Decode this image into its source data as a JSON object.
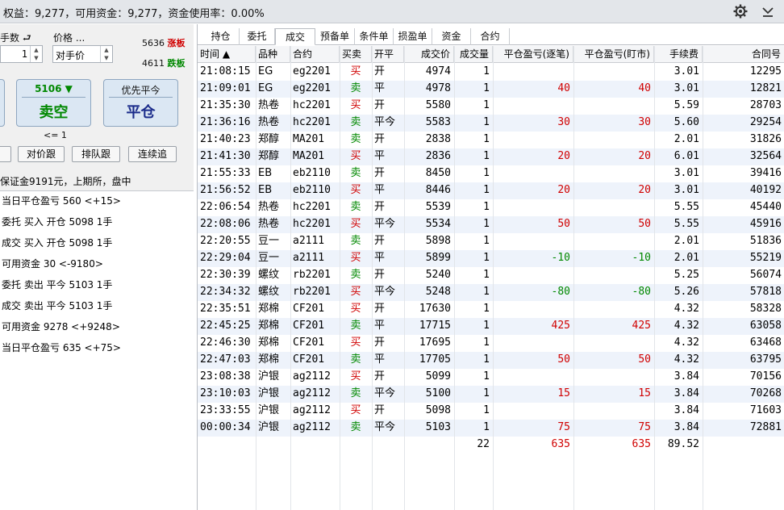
{
  "topbar": {
    "summary": "权益：9,277，可用资金：9,277，资金使用率：0.00%",
    "icons": [
      "gear-icon",
      "chevron-down-icon"
    ]
  },
  "order_panel": {
    "qty_label": "手数",
    "qty_value": "1",
    "price_label": "价格 ...",
    "price_value": "对手价",
    "limit_up_value": "5636",
    "limit_up_label": "涨板",
    "limit_down_value": "4611",
    "limit_down_label": "跌板",
    "sell_price": "5106",
    "sell_label": "卖空",
    "close_top": "优先平今",
    "close_label": "平仓",
    "hint": "<= 1",
    "btn_counter": "对价跟",
    "btn_queue": "排队跟",
    "btn_chase": "连续追",
    "margin_info": "保证金9191元，上期所，盘中"
  },
  "log": [
    "当日平仓盈亏 560  <+15>",
    "委托  买入  开仓  5098  1手",
    "成交  买入  开仓  5098  1手",
    "可用资金 30  <-9180>",
    "委托  卖出  平今  5103  1手",
    "成交  卖出  平今  5103  1手",
    "可用资金 9278  <+9248>",
    "当日平仓盈亏 635  <+75>"
  ],
  "tabs": [
    "持仓",
    "委托",
    "成交",
    "预备单",
    "条件单",
    "损盈单",
    "资金",
    "合约"
  ],
  "active_tab": 2,
  "columns": [
    "时间 ▲",
    "品种",
    "合约",
    "买卖",
    "开平",
    "成交价",
    "成交量",
    "平仓盈亏(逐笔)",
    "平仓盈亏(盯市)",
    "手续费",
    "合同号"
  ],
  "rows": [
    [
      "21:08:15",
      "EG",
      "eg2201",
      "买",
      "开",
      "4974",
      "1",
      "",
      "",
      "3.01",
      "12295"
    ],
    [
      "21:09:01",
      "EG",
      "eg2201",
      "卖",
      "平",
      "4978",
      "1",
      "40",
      "40",
      "3.01",
      "12821"
    ],
    [
      "21:35:30",
      "热卷",
      "hc2201",
      "买",
      "开",
      "5580",
      "1",
      "",
      "",
      "5.59",
      "28703"
    ],
    [
      "21:36:16",
      "热卷",
      "hc2201",
      "卖",
      "平今",
      "5583",
      "1",
      "30",
      "30",
      "5.60",
      "29254"
    ],
    [
      "21:40:23",
      "郑醇",
      "MA201",
      "卖",
      "开",
      "2838",
      "1",
      "",
      "",
      "2.01",
      "31826"
    ],
    [
      "21:41:30",
      "郑醇",
      "MA201",
      "买",
      "平",
      "2836",
      "1",
      "20",
      "20",
      "6.01",
      "32564"
    ],
    [
      "21:55:33",
      "EB",
      "eb2110",
      "卖",
      "开",
      "8450",
      "1",
      "",
      "",
      "3.01",
      "39416"
    ],
    [
      "21:56:52",
      "EB",
      "eb2110",
      "买",
      "平",
      "8446",
      "1",
      "20",
      "20",
      "3.01",
      "40192"
    ],
    [
      "22:06:54",
      "热卷",
      "hc2201",
      "卖",
      "开",
      "5539",
      "1",
      "",
      "",
      "5.55",
      "45440"
    ],
    [
      "22:08:06",
      "热卷",
      "hc2201",
      "买",
      "平今",
      "5534",
      "1",
      "50",
      "50",
      "5.55",
      "45916"
    ],
    [
      "22:20:55",
      "豆一",
      "a2111",
      "卖",
      "开",
      "5898",
      "1",
      "",
      "",
      "2.01",
      "51836"
    ],
    [
      "22:29:04",
      "豆一",
      "a2111",
      "买",
      "平",
      "5899",
      "1",
      "-10",
      "-10",
      "2.01",
      "55219"
    ],
    [
      "22:30:39",
      "螺纹",
      "rb2201",
      "卖",
      "开",
      "5240",
      "1",
      "",
      "",
      "5.25",
      "56074"
    ],
    [
      "22:34:32",
      "螺纹",
      "rb2201",
      "买",
      "平今",
      "5248",
      "1",
      "-80",
      "-80",
      "5.26",
      "57818"
    ],
    [
      "22:35:51",
      "郑棉",
      "CF201",
      "买",
      "开",
      "17630",
      "1",
      "",
      "",
      "4.32",
      "58328"
    ],
    [
      "22:45:25",
      "郑棉",
      "CF201",
      "卖",
      "平",
      "17715",
      "1",
      "425",
      "425",
      "4.32",
      "63058"
    ],
    [
      "22:46:30",
      "郑棉",
      "CF201",
      "买",
      "开",
      "17695",
      "1",
      "",
      "",
      "4.32",
      "63468"
    ],
    [
      "22:47:03",
      "郑棉",
      "CF201",
      "卖",
      "平",
      "17705",
      "1",
      "50",
      "50",
      "4.32",
      "63795"
    ],
    [
      "23:08:38",
      "沪银",
      "ag2112",
      "买",
      "开",
      "5099",
      "1",
      "",
      "",
      "3.84",
      "70156"
    ],
    [
      "23:10:03",
      "沪银",
      "ag2112",
      "卖",
      "平今",
      "5100",
      "1",
      "15",
      "15",
      "3.84",
      "70268"
    ],
    [
      "23:33:55",
      "沪银",
      "ag2112",
      "买",
      "开",
      "5098",
      "1",
      "",
      "",
      "3.84",
      "71603"
    ],
    [
      "00:00:34",
      "沪银",
      "ag2112",
      "卖",
      "平今",
      "5103",
      "1",
      "75",
      "75",
      "3.84",
      "72881"
    ]
  ],
  "totals": {
    "volume": "22",
    "pnl_trade": "635",
    "pnl_mtm": "635",
    "fee": "89.52"
  },
  "colors": {
    "buy": "#d00000",
    "sell": "#008800",
    "accent": "#1a2b8a"
  }
}
